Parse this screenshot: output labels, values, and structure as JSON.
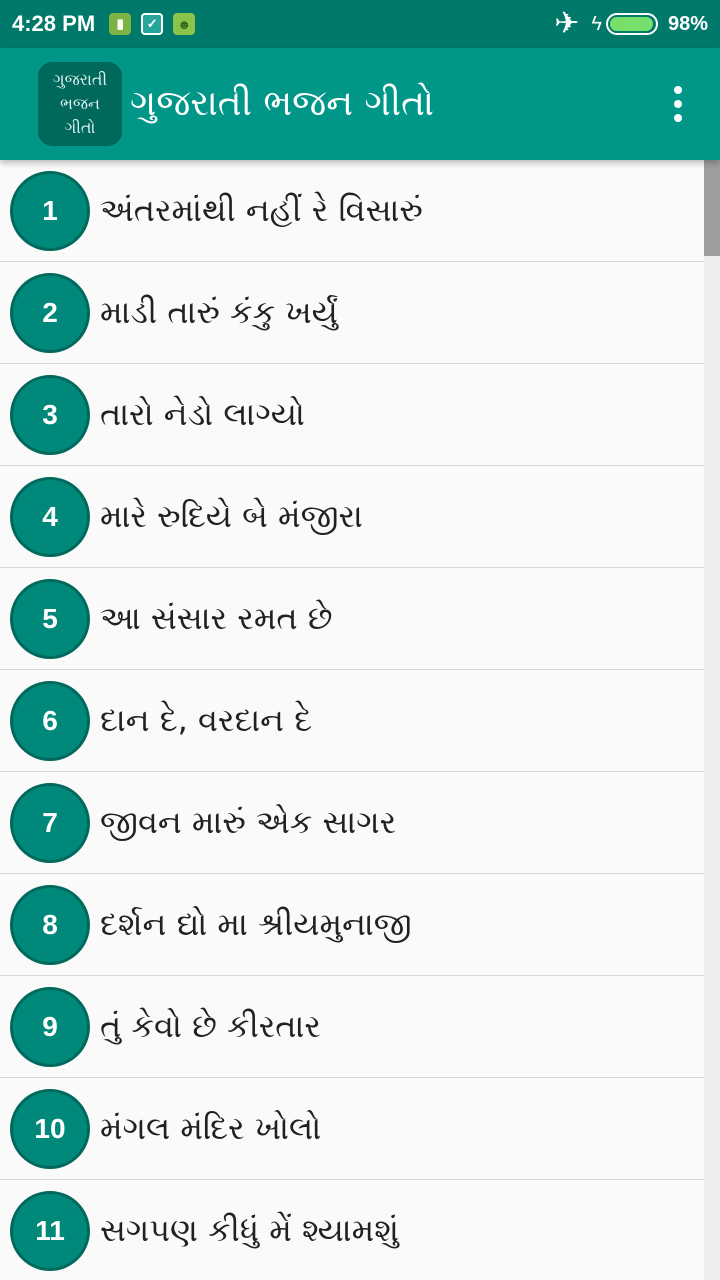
{
  "status_bar": {
    "time": "4:28 PM",
    "battery_pct": "98%",
    "battery_level": 0.98,
    "icons": [
      "sim-icon",
      "shield-icon",
      "android-icon",
      "airplane-icon",
      "charging-icon",
      "battery-icon"
    ]
  },
  "app_bar": {
    "logo_lines": [
      "ગુજરાતી",
      "ભજન",
      "ગીતો"
    ],
    "title": "ગુજરાતી ભજન ગીતો",
    "menu_icon": "more-vert-icon"
  },
  "colors": {
    "primary": "#009688",
    "primary_dark": "#00796b",
    "accent_circle": "#00897b"
  },
  "items": [
    {
      "num": "1",
      "title": "અંતરમાંથી નહીં રે વિસારું"
    },
    {
      "num": "2",
      "title": "માડી તારું કંકુ ખર્યું"
    },
    {
      "num": "3",
      "title": "તારો નેડો લાગ્યો"
    },
    {
      "num": "4",
      "title": "મારે રુદિયે બે મંજીરા"
    },
    {
      "num": "5",
      "title": "આ સંસાર રમત છે"
    },
    {
      "num": "6",
      "title": "દાન દે, વરદાન દે"
    },
    {
      "num": "7",
      "title": "જીવન મારું એક સાગર"
    },
    {
      "num": "8",
      "title": "દર્શન દ્યો મા શ્રીયમુનાજી"
    },
    {
      "num": "9",
      "title": "તું કેવો છે કીરતાર"
    },
    {
      "num": "10",
      "title": "મંગલ મંદિર ખોલો"
    },
    {
      "num": "11",
      "title": "સગપણ કીધું મેં શ્યામશું"
    }
  ]
}
